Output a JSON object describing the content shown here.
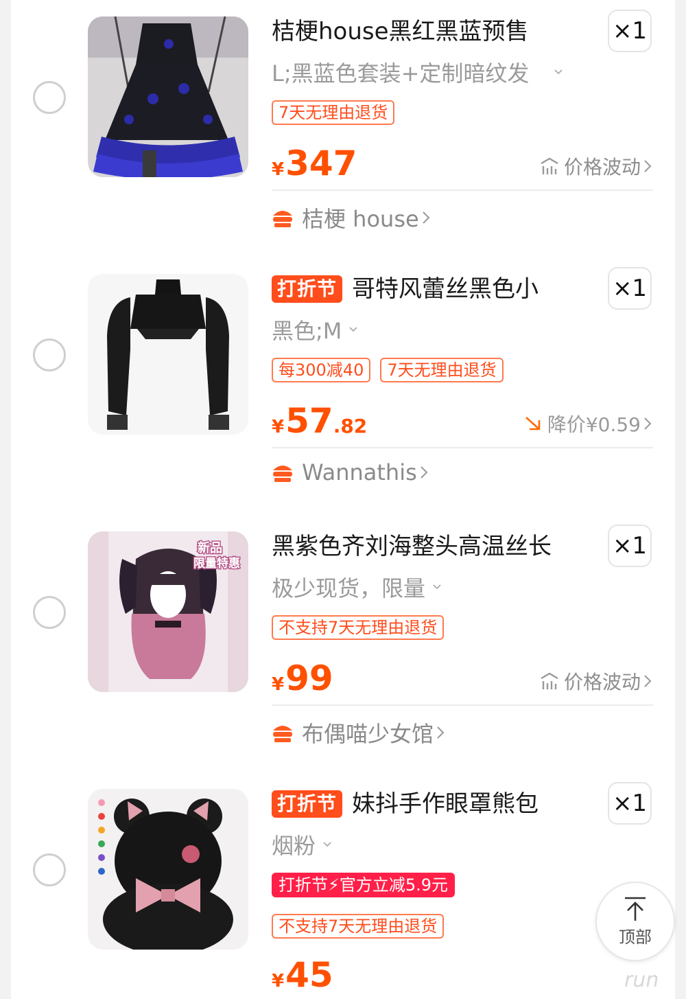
{
  "items": [
    {
      "promo": "",
      "title": "桔梗house黑红黑蓝预售",
      "qty": "×1",
      "sku": "L;黑蓝色套装+定制暗纹发",
      "badges": [
        "7天无理由退货"
      ],
      "price_symbol": "¥",
      "price_int": "347",
      "price_dec": "",
      "price_note": "价格波动",
      "price_note_icon": "price-trend-icon",
      "shop": "桔梗 house",
      "image": "black-blue-lolita-dress"
    },
    {
      "promo": "打折节",
      "title": "哥特风蕾丝黑色小",
      "qty": "×1",
      "sku": "黑色;M",
      "badges": [
        "每300减40",
        "7天无理由退货"
      ],
      "price_symbol": "¥",
      "price_int": "57",
      "price_dec": ".82",
      "price_note": "降价¥0.59",
      "price_note_icon": "arrow-down-right-icon",
      "shop": "Wannathis",
      "image": "black-lace-bolero"
    },
    {
      "promo": "",
      "title": "黑紫色齐刘海整头高温丝长",
      "qty": "×1",
      "sku": "极少现货，限量",
      "badges": [
        "不支持7天无理由退货"
      ],
      "price_symbol": "¥",
      "price_int": "99",
      "price_dec": "",
      "price_note": "价格波动",
      "price_note_icon": "price-trend-icon",
      "shop": "布偶喵少女馆",
      "image": "purple-gradient-wig",
      "image_label_1": "新品",
      "image_label_2": "限量特惠"
    },
    {
      "promo": "打折节",
      "title": "妹抖手作眼罩熊包",
      "qty": "×1",
      "sku": "烟粉",
      "solid_badge": "打折节⚡官方立减5.9元",
      "badges": [
        "不支持7天无理由退货"
      ],
      "price_symbol": "¥",
      "price_int": "45",
      "price_dec": "",
      "image": "black-bear-bag"
    }
  ],
  "back_to_top": "顶部",
  "watermark": "run",
  "colors": {
    "price": "#ff5000",
    "promo_bg": "#ff4d1c",
    "solid_badge_bg": "#ff1f48",
    "badge_border": "#ff7a4d"
  }
}
